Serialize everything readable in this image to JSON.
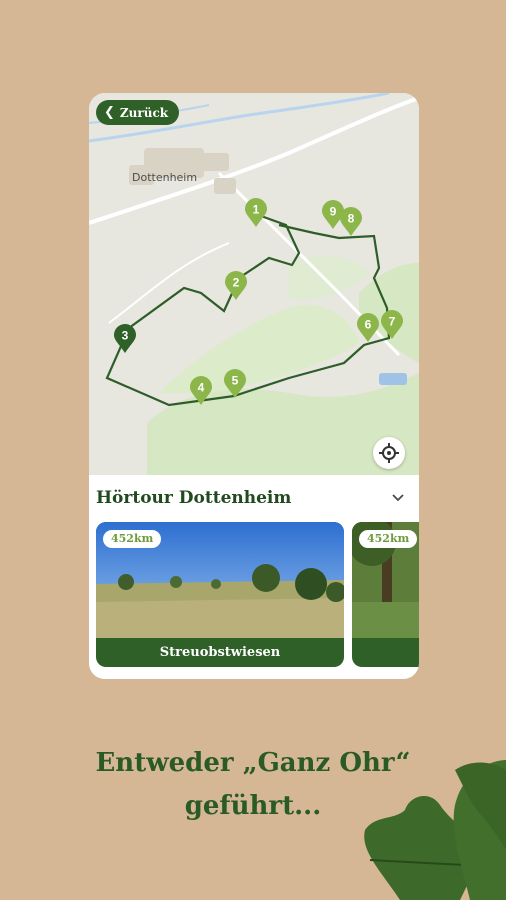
{
  "colors": {
    "background": "#d5b795",
    "brand_dark_green": "#2f6028",
    "marker_light_green": "#8db64a",
    "route_line": "#2e5e28",
    "tagline": "#2a5a26",
    "distance_text": "#6e9a3c"
  },
  "map": {
    "back_label": "Zurück",
    "back_icon": "chevron-left-icon",
    "town_label": "Dottenheim",
    "locate_icon": "crosshair-icon",
    "markers": [
      {
        "number": "1",
        "selected": false
      },
      {
        "number": "2",
        "selected": false
      },
      {
        "number": "3",
        "selected": true
      },
      {
        "number": "4",
        "selected": false
      },
      {
        "number": "5",
        "selected": false
      },
      {
        "number": "6",
        "selected": false
      },
      {
        "number": "7",
        "selected": false
      },
      {
        "number": "8",
        "selected": false
      },
      {
        "number": "9",
        "selected": false
      }
    ]
  },
  "tour": {
    "title": "Hörtour Dottenheim",
    "collapse_icon": "chevron-down-icon",
    "stations": [
      {
        "distance": "452km",
        "name": "Streuobstwiesen"
      },
      {
        "distance": "452km",
        "name": ""
      }
    ]
  },
  "tagline": {
    "line1": "Entweder „Ganz Ohr“",
    "line2": "geführt..."
  }
}
